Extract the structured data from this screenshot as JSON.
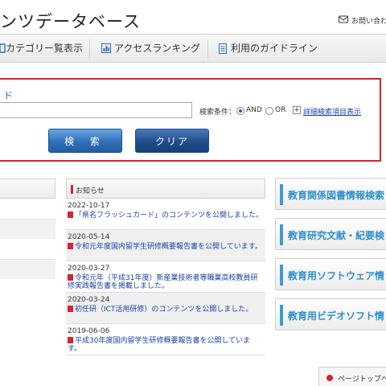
{
  "header": {
    "title": "ンツデータベース",
    "contact_label": "お問い合わ"
  },
  "nav": {
    "items": [
      {
        "label": "カテゴリー覧表示",
        "icon": "list-icon"
      },
      {
        "label": "アクセスランキング",
        "icon": "bar-chart-icon"
      },
      {
        "label": "利用のガイドライン",
        "icon": "document-icon"
      }
    ]
  },
  "search": {
    "title": "ド",
    "input_value": "",
    "condition_label": "検索条件：",
    "and_label": "AND",
    "or_label": "OR",
    "selected": "AND",
    "advanced_plus": "+",
    "advanced_label": "詳細検索項目表示",
    "search_button": "検 索",
    "clear_button": "クリア"
  },
  "news": {
    "title": "お知らせ",
    "items": [
      {
        "date": "2022-10-17",
        "text": "「県名フラッシュカード」のコンテンツを公開しました。"
      },
      {
        "date": "2020-05-14",
        "text": "令和元年度国内留学生研修概要報告書を公開しています。"
      },
      {
        "date": "2020-03-27",
        "text": "令和元年（平成31年度）新産業技術者等職業高校教員研修実践報告書を掲載しました。"
      },
      {
        "date": "2020-03-24",
        "text": "初任研（ICT活用研修）のコンテンツを公開しました。"
      },
      {
        "date": "2019-06-06",
        "text": "平成30年度国内留学生研修概要報告書を公開しています。"
      }
    ]
  },
  "sidebar": {
    "links": [
      {
        "label": "教育関係図書情報検索"
      },
      {
        "label": "教育研究文献・紀要検"
      },
      {
        "label": "教育用ソフトウェア情"
      },
      {
        "label": "教育用ビデオソフト情"
      }
    ]
  },
  "footer": {
    "page_top_label": "ページトップへ"
  },
  "colors": {
    "accent_red": "#d9232e",
    "link_blue": "#1a3fa8",
    "side_blue": "#2d8fcc",
    "button_blue": "#2f6fb8"
  }
}
